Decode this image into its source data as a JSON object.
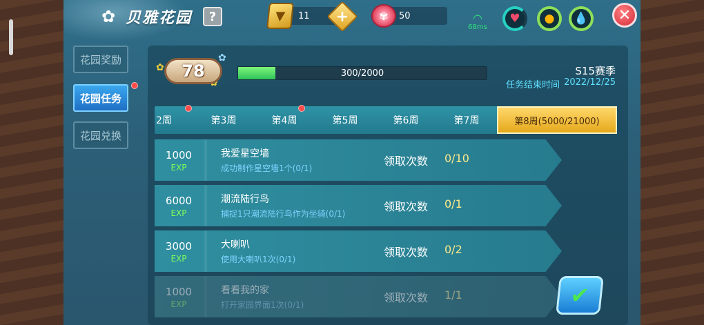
{
  "header": {
    "title": "贝雅花园",
    "help_label": "?",
    "gold_amount": "11",
    "plus_label": "+",
    "gem_amount": "50",
    "network_label": "68ms",
    "close_label": "✕"
  },
  "sidebar": {
    "items": [
      {
        "label": "花园奖励",
        "active": false,
        "dot": false
      },
      {
        "label": "花园任务",
        "active": true,
        "dot": true
      },
      {
        "label": "花园兑换",
        "active": false,
        "dot": false
      }
    ]
  },
  "season": {
    "level": "78",
    "progress_text": "300/2000",
    "progress_fraction": 0.15,
    "name": "S15赛季",
    "end_label": "任务结束时间",
    "end_date": "2022/12/25"
  },
  "weeks": [
    {
      "label": "2周",
      "dot": true
    },
    {
      "label": "第3周",
      "dot": false
    },
    {
      "label": "第4周",
      "dot": true
    },
    {
      "label": "第5周",
      "dot": false
    },
    {
      "label": "第6周",
      "dot": false
    },
    {
      "label": "第7周",
      "dot": false
    },
    {
      "label": "第8周(5000/21000)",
      "dot": false
    }
  ],
  "tasks": [
    {
      "exp": "1000",
      "exp_label": "EXP",
      "name": "我爱星空墙",
      "desc": "成功制作星空墙1个(0/1)",
      "count_label": "领取次数",
      "count": "0/10"
    },
    {
      "exp": "6000",
      "exp_label": "EXP",
      "name": "潮流陆行鸟",
      "desc": "捕捉1只潮流陆行鸟作为坐骑(0/1)",
      "count_label": "领取次数",
      "count": "0/1"
    },
    {
      "exp": "3000",
      "exp_label": "EXP",
      "name": "大喇叭",
      "desc": "使用大喇叭1次(0/1)",
      "count_label": "领取次数",
      "count": "0/2"
    },
    {
      "exp": "1000",
      "exp_label": "EXP",
      "name": "看看我的家",
      "desc": "打开家园界面1次(0/1)",
      "count_label": "领取次数",
      "count": "1/1"
    }
  ],
  "icons": {
    "flower": "flower-icon",
    "gold": "gold-ticket-icon",
    "gem": "flower-gem-icon",
    "heart": "heart-icon",
    "food": "food-icon",
    "water": "water-drop-icon",
    "check": "check-icon"
  },
  "colors": {
    "panel": "#2c5f78",
    "active_tab": "#1f6fc4",
    "active_week": "#e5a81c",
    "exp_green": "#7dff5a",
    "count_yellow": "#ffe98a",
    "desc_blue": "#7fd2ff"
  }
}
